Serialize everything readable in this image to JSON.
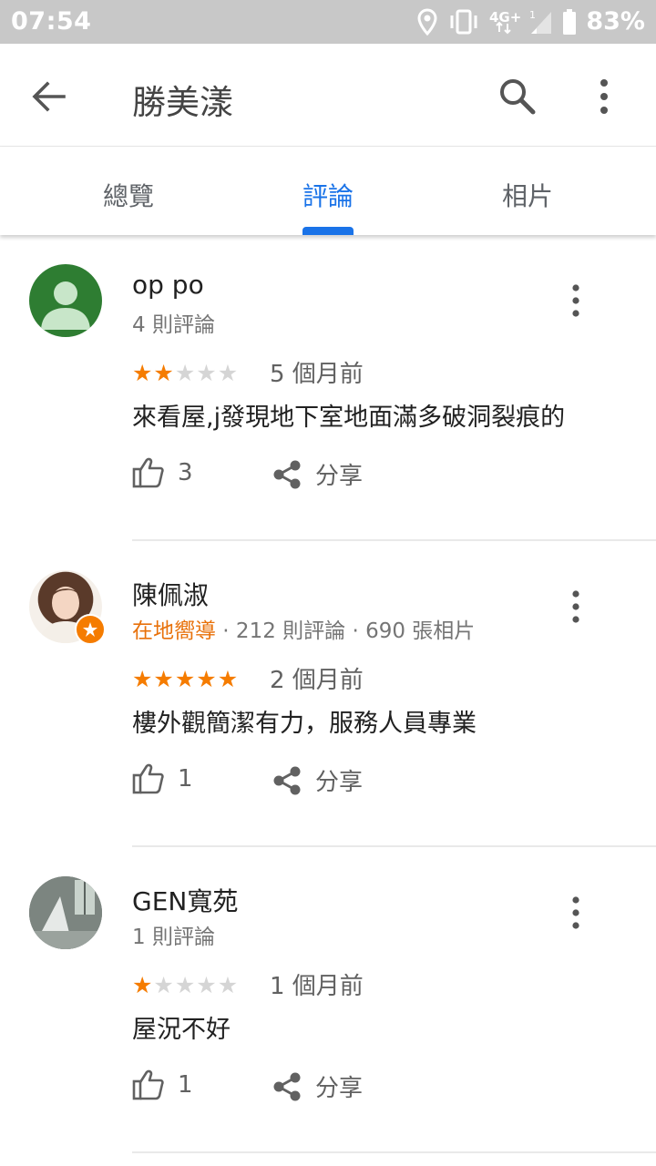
{
  "status_bar": {
    "time": "07:54",
    "battery": "83%",
    "network": "4G+"
  },
  "app_bar": {
    "title": "勝美漾"
  },
  "tabs": [
    {
      "label": "總覽"
    },
    {
      "label": "評論"
    },
    {
      "label": "相片"
    }
  ],
  "active_tab": "評論",
  "colors": {
    "accent": "#1a73e8",
    "star": "#f57c00",
    "local_guide": "#e8710a"
  },
  "reviews": [
    {
      "author": "op po",
      "meta": "4 則評論",
      "rating": 2,
      "date": "5 個月前",
      "text": "來看屋,j發現地下室地面滿多破洞裂痕的",
      "likes": "3",
      "share_label": "分享",
      "avatar": "default-person-avatar"
    },
    {
      "author": "陳佩淑",
      "guide_label": "在地嚮導",
      "meta": " · 212 則評論 · 690 張相片",
      "rating": 5,
      "date": "2 個月前",
      "text": "樓外觀簡潔有力，服務人員專業",
      "likes": "1",
      "share_label": "分享",
      "avatar": "profile-photo"
    },
    {
      "author": "GEN寬苑",
      "meta": "1 則評論",
      "rating": 1,
      "date": "1 個月前",
      "text": "屋況不好",
      "likes": "1",
      "share_label": "分享",
      "avatar": "room-photo"
    }
  ]
}
